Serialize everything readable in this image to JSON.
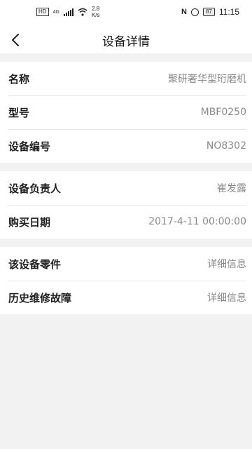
{
  "status": {
    "hd": "HD",
    "network": "4G",
    "speed_value": "2.8",
    "speed_unit": "K/s",
    "nfc": "N",
    "battery": "87",
    "time": "11:15"
  },
  "header": {
    "title": "设备详情"
  },
  "groups": [
    {
      "rows": [
        {
          "label": "名称",
          "value": "聚研奢华型珩磨机"
        },
        {
          "label": "型号",
          "value": "MBF0250"
        },
        {
          "label": "设备编号",
          "value": "NO8302"
        }
      ]
    },
    {
      "rows": [
        {
          "label": "设备负责人",
          "value": "崔发露"
        },
        {
          "label": "购买日期",
          "value": "2017-4-11 00:00:00"
        }
      ]
    },
    {
      "rows": [
        {
          "label": "该设备零件",
          "value": "详细信息"
        },
        {
          "label": "历史维修故障",
          "value": "详细信息"
        }
      ]
    }
  ]
}
